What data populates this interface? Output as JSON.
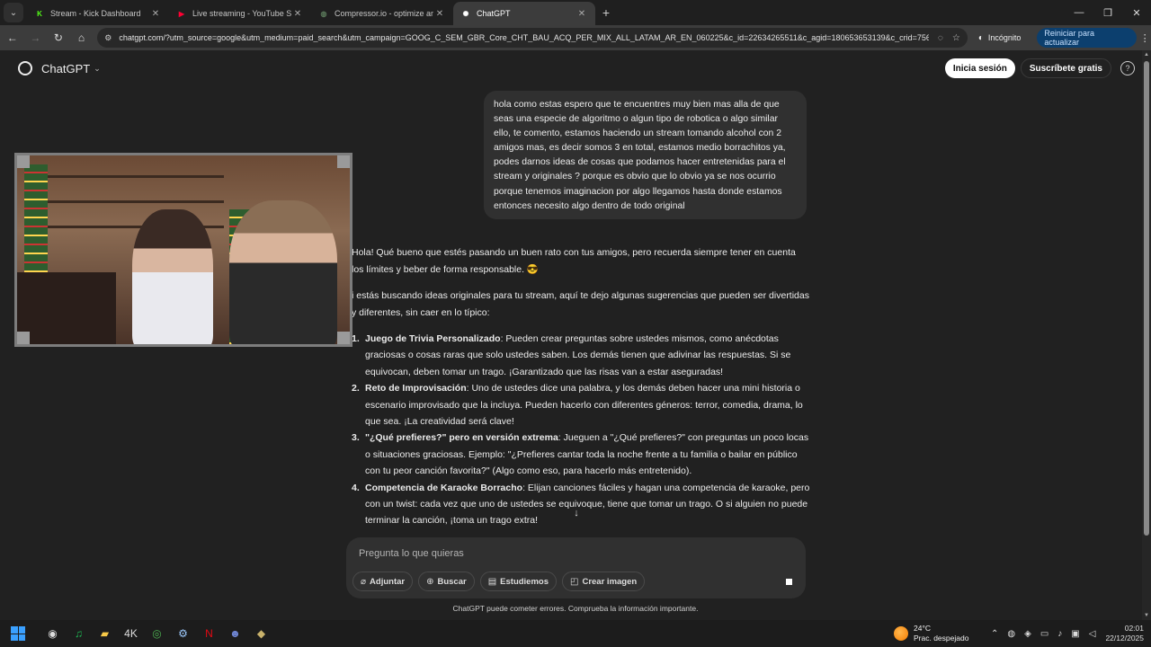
{
  "browser": {
    "tabs": [
      {
        "title": "Stream - Kick Dashboard",
        "favicon": "kick-icon",
        "color": "#53fc18",
        "glyph": "K"
      },
      {
        "title": "Live streaming - YouTube Studio",
        "favicon": "youtube-icon",
        "color": "#ff0033",
        "glyph": "▶"
      },
      {
        "title": "Compressor.io - optimize and compress",
        "favicon": "compressor-icon",
        "color": "#5a7a5a",
        "glyph": "◍"
      },
      {
        "title": "ChatGPT",
        "favicon": "chatgpt-icon",
        "color": "#ffffff",
        "glyph": "✺"
      }
    ],
    "active_tab_index": 3,
    "url": "chatgpt.com/?utm_source=google&utm_medium=paid_search&utm_campaign=GOOG_C_SEM_GBR_Core_CHT_BAU_ACQ_PER_MIX_ALL_LATAM_AR_EN_060225&c_id=22634265511&c_agid=180653653139&c_crid=7560...",
    "incognito_label": "Incógnito",
    "restart_label": "Reiniciar para actualizar"
  },
  "header": {
    "brand": "ChatGPT",
    "login_label": "Inicia sesión",
    "subscribe_label": "Suscríbete gratis",
    "help_glyph": "?"
  },
  "conversation": {
    "user_message": "hola como estas espero que te encuentres muy bien mas alla de que seas una especie de algoritmo o algun tipo de robotica o algo similar ello, te comento, estamos haciendo un stream tomando alcohol con 2 amigos mas, es decir somos 3 en total, estamos medio borrachitos ya, podes darnos ideas de cosas que podamos hacer entretenidas para el stream y originales ? porque es obvio que lo obvio ya se nos ocurrio porque tenemos imaginacion por algo llegamos hasta donde estamos entonces necesito algo dentro de todo original",
    "assistant_intro_1": "Hola! Qué bueno que estés pasando un buen rato con tus amigos, pero recuerda siempre tener en cuenta los límites y beber de forma responsable. 😎",
    "assistant_intro_2": "i estás buscando ideas originales para tu stream, aquí te dejo algunas sugerencias que pueden ser divertidas y diferentes, sin caer en lo típico:",
    "items": [
      {
        "num": "1.",
        "title": "Juego de Trivia Personalizado",
        "text": ": Pueden crear preguntas sobre ustedes mismos, como anécdotas graciosas o cosas raras que solo ustedes saben. Los demás tienen que adivinar las respuestas. Si se equivocan, deben tomar un trago. ¡Garantizado que las risas van a estar aseguradas!"
      },
      {
        "num": "2.",
        "title": "Reto de Improvisación",
        "text": ": Uno de ustedes dice una palabra, y los demás deben hacer una mini historia o escenario improvisado que la incluya. Pueden hacerlo con diferentes géneros: terror, comedia, drama, lo que sea. ¡La creatividad será clave!"
      },
      {
        "num": "3.",
        "title": "\"¿Qué prefieres?\" pero en versión extrema",
        "text": ": Jueguen a \"¿Qué prefieres?\" con preguntas un poco locas o situaciones graciosas. Ejemplo: \"¿Prefieres cantar toda la noche frente a tu familia o bailar en público con tu peor canción favorita?\" (Algo como eso, para hacerlo más entretenido)."
      },
      {
        "num": "4.",
        "title": "Competencia de Karaoke Borracho",
        "text": ": Elijan canciones fáciles y hagan una competencia de karaoke, pero con un twist: cada vez que uno de ustedes se equivoque, tiene que tomar un trago. O si alguien no puede terminar la canción, ¡toma un trago extra!"
      }
    ]
  },
  "composer": {
    "placeholder": "Pregunta lo que quieras",
    "tools": [
      {
        "label": "Adjuntar",
        "icon": "paperclip-icon",
        "glyph": "⌀"
      },
      {
        "label": "Buscar",
        "icon": "globe-icon",
        "glyph": "⊕"
      },
      {
        "label": "Estudiemos",
        "icon": "book-icon",
        "glyph": "▤"
      },
      {
        "label": "Crear imagen",
        "icon": "image-icon",
        "glyph": "◰"
      }
    ]
  },
  "disclaimer": "ChatGPT puede cometer errores. Comprueba la información importante.",
  "taskbar": {
    "weather_temp": "24°C",
    "weather_desc": "Prac. despejado",
    "time": "02:01",
    "date": "22/12/2025",
    "apps": [
      {
        "name": "obs-icon",
        "glyph": "◉",
        "color": "#ddd"
      },
      {
        "name": "spotify-icon",
        "glyph": "♫",
        "color": "#1db954"
      },
      {
        "name": "file-explorer-icon",
        "glyph": "▰",
        "color": "#f7c948"
      },
      {
        "name": "4k-downloader-icon",
        "glyph": "4K",
        "color": "#ddd"
      },
      {
        "name": "chrome-icon",
        "glyph": "◎",
        "color": "#4caf50"
      },
      {
        "name": "steam-icon",
        "glyph": "⚙",
        "color": "#9ecbff"
      },
      {
        "name": "netflix-icon",
        "glyph": "N",
        "color": "#e50914"
      },
      {
        "name": "discord-icon",
        "glyph": "☻",
        "color": "#7289da"
      },
      {
        "name": "app-icon",
        "glyph": "◆",
        "color": "#c9b26b"
      }
    ]
  }
}
